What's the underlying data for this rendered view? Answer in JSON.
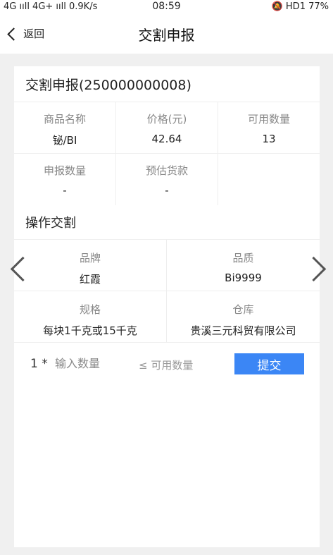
{
  "status_bar": {
    "signal_left": "4G ııll 4G+ ııll 0.9K/s",
    "time": "08:59",
    "signal_right": "HD1 77%"
  },
  "nav": {
    "back_label": "返回",
    "title": "交割申报"
  },
  "card": {
    "title": "交割申报(250000000008)",
    "info": [
      {
        "label": "商品名称",
        "value": "铋/BI"
      },
      {
        "label": "价格(元)",
        "value": "42.64"
      },
      {
        "label": "可用数量",
        "value": "13"
      },
      {
        "label": "申报数量",
        "value": "-"
      },
      {
        "label": "预估货款",
        "value": "-"
      }
    ],
    "ops_title": "操作交割",
    "ops": [
      {
        "label": "品牌",
        "value": "红霞"
      },
      {
        "label": "品质",
        "value": "Bi9999"
      },
      {
        "label": "规格",
        "value": "每块1千克或15千克"
      },
      {
        "label": "仓库",
        "value": "贵溪三元科贸有限公司"
      }
    ],
    "qty_prefix": "1 *",
    "qty_placeholder": "输入数量",
    "qty_hint": "≤ 可用数量",
    "submit_label": "提交"
  }
}
